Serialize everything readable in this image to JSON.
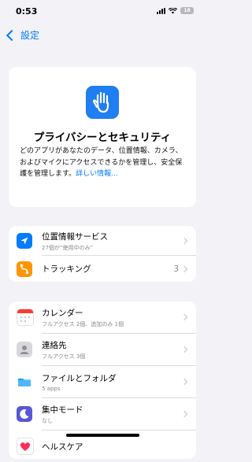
{
  "status": {
    "time": "0:53",
    "battery": "18"
  },
  "nav": {
    "back_label": "設定"
  },
  "header": {
    "title": "プライバシーとセキュリティ",
    "body": "どのアプリがあなたのデータ、位置情報、カメラ、およびマイクにアクセスできるかを管理し、安全保護を管理します。",
    "link": "詳しい情報..."
  },
  "group1": [
    {
      "label": "位置情報サービス",
      "sub": "27個が“使用中のみ”",
      "value": ""
    },
    {
      "label": "トラッキング",
      "sub": "",
      "value": "3"
    }
  ],
  "group2": [
    {
      "label": "カレンダー",
      "sub": "フルアクセス 2個、追加のみ 1個"
    },
    {
      "label": "連絡先",
      "sub": "フルアクセス 3個"
    },
    {
      "label": "ファイルとフォルダ",
      "sub": "5 apps"
    },
    {
      "label": "集中モード",
      "sub": "なし"
    },
    {
      "label": "ヘルスケア",
      "sub": ""
    }
  ],
  "colors": {
    "accent": "#007aff",
    "location": "#007aff",
    "tracking": "#ff9500",
    "focus": "#5856d6"
  }
}
